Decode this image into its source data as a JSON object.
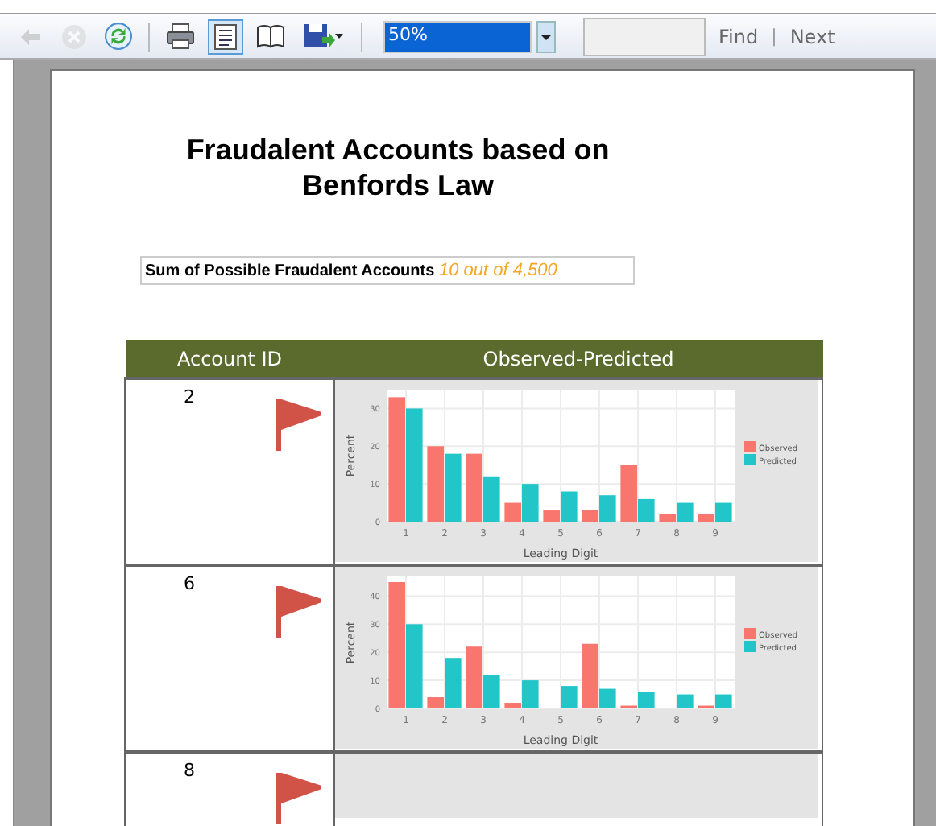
{
  "toolbar": {
    "tools": [
      {
        "kind": "back",
        "disabled": true,
        "selected": false
      },
      {
        "kind": "stop",
        "disabled": true,
        "selected": false
      },
      {
        "kind": "refresh",
        "disabled": false,
        "selected": false
      },
      {
        "kind": "print",
        "disabled": false,
        "selected": false
      },
      {
        "kind": "layout",
        "disabled": false,
        "selected": true
      },
      {
        "kind": "book",
        "disabled": false,
        "selected": false
      },
      {
        "kind": "save",
        "disabled": false,
        "selected": false
      }
    ],
    "zoom": "50%",
    "find_label": "Find",
    "separator": "|",
    "next_label": "Next"
  },
  "report": {
    "title": "Fraudalent Accounts based on Benfords Law",
    "summary_label": "Sum of Possible Fraudalent Accounts",
    "summary_value": "10 out of 4,500",
    "table": {
      "columns": [
        "Account ID",
        "Observed-Predicted"
      ],
      "rows": [
        {
          "account_id": "2",
          "flagged": true,
          "chart_data": {
            "type": "bar",
            "grid": true,
            "legend": "right",
            "xlabel": "Leading Digit",
            "ylabel": "Percent",
            "categories": [
              "1",
              "2",
              "3",
              "4",
              "5",
              "6",
              "7",
              "8",
              "9"
            ],
            "ylim": [
              0,
              35
            ],
            "yticks": [
              0,
              10,
              20,
              30
            ],
            "series": [
              {
                "name": "Observed",
                "color": "#f8766d",
                "values": [
                  33,
                  20,
                  18,
                  5,
                  3,
                  3,
                  15,
                  2,
                  2
                ]
              },
              {
                "name": "Predicted",
                "color": "#22c5c8",
                "values": [
                  30,
                  18,
                  12,
                  10,
                  8,
                  7,
                  6,
                  5,
                  5
                ]
              }
            ]
          }
        },
        {
          "account_id": "6",
          "flagged": true,
          "chart_data": {
            "type": "bar",
            "grid": true,
            "legend": "right",
            "xlabel": "Leading Digit",
            "ylabel": "Percent",
            "categories": [
              "1",
              "2",
              "3",
              "4",
              "5",
              "6",
              "7",
              "8",
              "9"
            ],
            "ylim": [
              0,
              47
            ],
            "yticks": [
              0,
              10,
              20,
              30,
              40
            ],
            "series": [
              {
                "name": "Observed",
                "color": "#f8766d",
                "values": [
                  45,
                  4,
                  22,
                  2,
                  0,
                  23,
                  1,
                  0,
                  1
                ]
              },
              {
                "name": "Predicted",
                "color": "#22c5c8",
                "values": [
                  30,
                  18,
                  12,
                  10,
                  8,
                  7,
                  6,
                  5,
                  5
                ]
              }
            ]
          }
        },
        {
          "account_id": "8",
          "flagged": true
        }
      ]
    }
  }
}
